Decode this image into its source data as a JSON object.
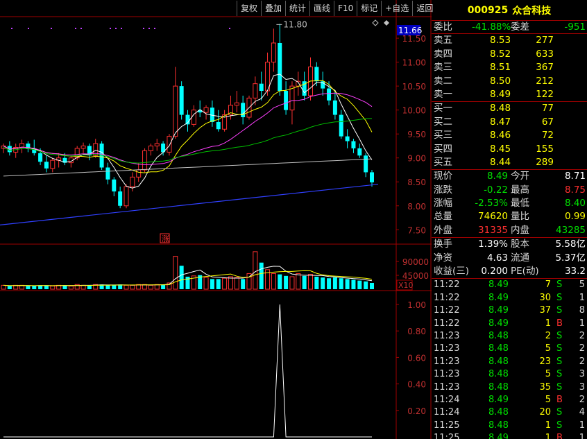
{
  "toolbar": [
    "复权",
    "叠加",
    "统计",
    "画线",
    "F10",
    "标记",
    "+自选",
    "返回"
  ],
  "quote": {
    "code": "000925",
    "name": "众合科技",
    "weibi_label": "委比",
    "weibi": "-41.88%",
    "weicha_label": "委差",
    "weicha": "-951",
    "asks": [
      {
        "label": "卖五",
        "price": "8.53",
        "vol": "277"
      },
      {
        "label": "卖四",
        "price": "8.52",
        "vol": "633"
      },
      {
        "label": "卖三",
        "price": "8.51",
        "vol": "367"
      },
      {
        "label": "卖二",
        "price": "8.50",
        "vol": "212"
      },
      {
        "label": "卖一",
        "price": "8.49",
        "vol": "122"
      }
    ],
    "bids": [
      {
        "label": "买一",
        "price": "8.48",
        "vol": "77"
      },
      {
        "label": "买二",
        "price": "8.47",
        "vol": "67"
      },
      {
        "label": "买三",
        "price": "8.46",
        "vol": "72"
      },
      {
        "label": "买四",
        "price": "8.45",
        "vol": "155"
      },
      {
        "label": "买五",
        "price": "8.44",
        "vol": "289"
      }
    ],
    "stats": [
      {
        "l1": "现价",
        "v1": "8.49",
        "c1": "dn",
        "l2": "今开",
        "v2": "8.71",
        "c2": "wh"
      },
      {
        "l1": "涨跌",
        "v1": "-0.22",
        "c1": "dn",
        "l2": "最高",
        "v2": "8.75",
        "c2": "up"
      },
      {
        "l1": "涨幅",
        "v1": "-2.53%",
        "c1": "dn",
        "l2": "最低",
        "v2": "8.40",
        "c2": "dn"
      },
      {
        "l1": "总量",
        "v1": "74620",
        "c1": "yl",
        "l2": "量比",
        "v2": "0.99",
        "c2": "yl"
      },
      {
        "l1": "外盘",
        "v1": "31335",
        "c1": "up",
        "l2": "内盘",
        "v2": "43285",
        "c2": "dn"
      }
    ],
    "stats2": [
      {
        "l1": "换手",
        "v1": "1.39%",
        "l2": "股本",
        "v2": "5.58亿"
      },
      {
        "l1": "净资",
        "v1": "4.63",
        "l2": "流通",
        "v2": "5.37亿"
      },
      {
        "l1": "收益(三)",
        "v1": "0.200",
        "l2": "PE(动)",
        "v2": "33.2"
      }
    ]
  },
  "ticks": [
    {
      "t": "11:22",
      "p": "8.49",
      "v": "7",
      "bs": "S",
      "n": "5"
    },
    {
      "t": "11:22",
      "p": "8.49",
      "v": "30",
      "bs": "S",
      "n": "1"
    },
    {
      "t": "11:22",
      "p": "8.49",
      "v": "37",
      "bs": "S",
      "n": "8"
    },
    {
      "t": "11:22",
      "p": "8.49",
      "v": "1",
      "bs": "B",
      "n": "1"
    },
    {
      "t": "11:23",
      "p": "8.48",
      "v": "2",
      "bs": "S",
      "n": "2"
    },
    {
      "t": "11:23",
      "p": "8.48",
      "v": "5",
      "bs": "S",
      "n": "2"
    },
    {
      "t": "11:23",
      "p": "8.48",
      "v": "23",
      "bs": "S",
      "n": "2"
    },
    {
      "t": "11:23",
      "p": "8.48",
      "v": "5",
      "bs": "S",
      "n": "3"
    },
    {
      "t": "11:23",
      "p": "8.48",
      "v": "35",
      "bs": "S",
      "n": "3"
    },
    {
      "t": "11:24",
      "p": "8.49",
      "v": "5",
      "bs": "B",
      "n": "2"
    },
    {
      "t": "11:24",
      "p": "8.48",
      "v": "20",
      "bs": "S",
      "n": "4"
    },
    {
      "t": "11:25",
      "p": "8.48",
      "v": "1",
      "bs": "S",
      "n": "1"
    },
    {
      "t": "11:25",
      "p": "8.49",
      "v": "1",
      "bs": "B",
      "n": "1"
    }
  ],
  "chart_data": {
    "type": "candlestick",
    "price_axis": {
      "min": 7.5,
      "max": 11.5,
      "ticks": [
        "11.50",
        "11.00",
        "10.50",
        "10.00",
        "9.50",
        "9.00",
        "8.50",
        "8.00",
        "7.50"
      ]
    },
    "current_price_label": "11.66",
    "high_annotation": "11.80",
    "limit_marker": "涨",
    "volume_axis": {
      "ticks": [
        "90000",
        "45000"
      ],
      "unit": "X10"
    },
    "indicator_axis": {
      "ticks": [
        "1.00",
        "0.80",
        "0.60",
        "0.40",
        "0.20"
      ]
    },
    "candles": [
      [
        9.2,
        9.3,
        9.1,
        9.25
      ],
      [
        9.25,
        9.35,
        9.05,
        9.12
      ],
      [
        9.12,
        9.3,
        9.0,
        9.22
      ],
      [
        9.22,
        9.38,
        9.1,
        9.3
      ],
      [
        9.3,
        9.35,
        9.12,
        9.2
      ],
      [
        9.2,
        9.38,
        9.05,
        9.1
      ],
      [
        9.1,
        9.2,
        8.85,
        8.92
      ],
      [
        8.92,
        9.05,
        8.7,
        8.78
      ],
      [
        8.78,
        9.0,
        8.7,
        8.95
      ],
      [
        8.95,
        9.1,
        8.8,
        9.0
      ],
      [
        9.0,
        9.1,
        8.85,
        8.9
      ],
      [
        8.9,
        9.05,
        8.8,
        9.0
      ],
      [
        9.0,
        9.25,
        8.95,
        9.2
      ],
      [
        9.2,
        9.32,
        9.1,
        9.25
      ],
      [
        9.25,
        9.3,
        8.95,
        9.05
      ],
      [
        9.05,
        9.4,
        9.0,
        9.3
      ],
      [
        9.3,
        9.35,
        8.75,
        8.8
      ],
      [
        8.8,
        8.9,
        8.45,
        8.55
      ],
      [
        8.55,
        8.6,
        8.2,
        8.3
      ],
      [
        8.3,
        8.4,
        7.95,
        8.0
      ],
      [
        8.0,
        8.45,
        7.95,
        8.4
      ],
      [
        8.4,
        8.7,
        8.3,
        8.6
      ],
      [
        8.6,
        8.9,
        8.5,
        8.75
      ],
      [
        8.75,
        9.2,
        8.7,
        9.15
      ],
      [
        9.15,
        9.3,
        9.05,
        9.25
      ],
      [
        9.25,
        9.4,
        9.15,
        9.3
      ],
      [
        9.3,
        9.35,
        9.05,
        9.12
      ],
      [
        9.12,
        9.5,
        9.05,
        9.45
      ],
      [
        9.45,
        10.9,
        9.4,
        10.5
      ],
      [
        10.5,
        10.6,
        9.8,
        9.9
      ],
      [
        9.9,
        10.0,
        9.55,
        9.7
      ],
      [
        9.7,
        10.1,
        9.65,
        10.0
      ],
      [
        10.0,
        10.2,
        9.85,
        9.95
      ],
      [
        9.95,
        10.1,
        9.8,
        10.05
      ],
      [
        10.05,
        10.2,
        9.65,
        9.75
      ],
      [
        9.75,
        10.0,
        9.55,
        9.6
      ],
      [
        9.6,
        10.0,
        9.55,
        9.9
      ],
      [
        9.9,
        10.3,
        9.8,
        10.1
      ],
      [
        10.1,
        10.4,
        9.95,
        10.15
      ],
      [
        10.15,
        10.3,
        9.7,
        9.85
      ],
      [
        9.85,
        10.3,
        9.8,
        10.25
      ],
      [
        10.25,
        10.7,
        10.1,
        10.55
      ],
      [
        10.55,
        10.8,
        10.2,
        10.4
      ],
      [
        10.4,
        11.2,
        10.3,
        11.0
      ],
      [
        11.0,
        11.7,
        10.8,
        11.4
      ],
      [
        11.4,
        11.8,
        10.3,
        10.4
      ],
      [
        10.4,
        10.6,
        9.9,
        10.0
      ],
      [
        10.0,
        10.6,
        9.7,
        10.5
      ],
      [
        10.5,
        10.8,
        10.3,
        10.6
      ],
      [
        10.6,
        10.8,
        10.2,
        10.3
      ],
      [
        10.3,
        11.1,
        10.2,
        10.9
      ],
      [
        10.9,
        11.0,
        10.5,
        10.6
      ],
      [
        10.6,
        10.8,
        10.3,
        10.45
      ],
      [
        10.45,
        10.6,
        10.1,
        10.2
      ],
      [
        10.2,
        10.4,
        9.8,
        9.9
      ],
      [
        9.9,
        10.0,
        9.4,
        9.45
      ],
      [
        9.45,
        9.6,
        9.2,
        9.35
      ],
      [
        9.35,
        9.4,
        9.1,
        9.2
      ],
      [
        9.2,
        9.3,
        9.0,
        9.05
      ],
      [
        9.05,
        9.1,
        8.6,
        8.7
      ],
      [
        8.7,
        8.75,
        8.4,
        8.49
      ]
    ],
    "volumes": [
      5,
      4,
      5,
      5,
      4,
      4,
      5,
      5,
      4,
      5,
      5,
      4,
      6,
      5,
      5,
      6,
      6,
      5,
      5,
      6,
      5,
      5,
      6,
      6,
      5,
      6,
      6,
      8,
      42,
      30,
      16,
      17,
      18,
      15,
      13,
      13,
      14,
      16,
      15,
      13,
      20,
      48,
      34,
      25,
      20,
      19,
      17,
      16,
      20,
      17,
      19,
      16,
      15,
      14,
      15,
      14,
      13,
      12,
      11,
      10,
      8
    ],
    "indicator_peak": {
      "index": 45,
      "value": 1.0
    }
  }
}
